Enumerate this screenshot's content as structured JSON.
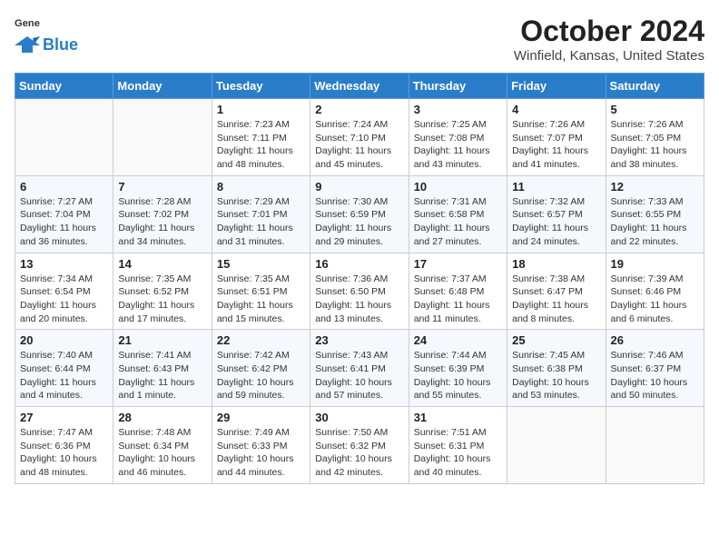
{
  "header": {
    "logo_general": "General",
    "logo_blue": "Blue",
    "month_title": "October 2024",
    "location": "Winfield, Kansas, United States"
  },
  "weekdays": [
    "Sunday",
    "Monday",
    "Tuesday",
    "Wednesday",
    "Thursday",
    "Friday",
    "Saturday"
  ],
  "weeks": [
    [
      {
        "day": "",
        "info": ""
      },
      {
        "day": "",
        "info": ""
      },
      {
        "day": "1",
        "info": "Sunrise: 7:23 AM\nSunset: 7:11 PM\nDaylight: 11 hours and 48 minutes."
      },
      {
        "day": "2",
        "info": "Sunrise: 7:24 AM\nSunset: 7:10 PM\nDaylight: 11 hours and 45 minutes."
      },
      {
        "day": "3",
        "info": "Sunrise: 7:25 AM\nSunset: 7:08 PM\nDaylight: 11 hours and 43 minutes."
      },
      {
        "day": "4",
        "info": "Sunrise: 7:26 AM\nSunset: 7:07 PM\nDaylight: 11 hours and 41 minutes."
      },
      {
        "day": "5",
        "info": "Sunrise: 7:26 AM\nSunset: 7:05 PM\nDaylight: 11 hours and 38 minutes."
      }
    ],
    [
      {
        "day": "6",
        "info": "Sunrise: 7:27 AM\nSunset: 7:04 PM\nDaylight: 11 hours and 36 minutes."
      },
      {
        "day": "7",
        "info": "Sunrise: 7:28 AM\nSunset: 7:02 PM\nDaylight: 11 hours and 34 minutes."
      },
      {
        "day": "8",
        "info": "Sunrise: 7:29 AM\nSunset: 7:01 PM\nDaylight: 11 hours and 31 minutes."
      },
      {
        "day": "9",
        "info": "Sunrise: 7:30 AM\nSunset: 6:59 PM\nDaylight: 11 hours and 29 minutes."
      },
      {
        "day": "10",
        "info": "Sunrise: 7:31 AM\nSunset: 6:58 PM\nDaylight: 11 hours and 27 minutes."
      },
      {
        "day": "11",
        "info": "Sunrise: 7:32 AM\nSunset: 6:57 PM\nDaylight: 11 hours and 24 minutes."
      },
      {
        "day": "12",
        "info": "Sunrise: 7:33 AM\nSunset: 6:55 PM\nDaylight: 11 hours and 22 minutes."
      }
    ],
    [
      {
        "day": "13",
        "info": "Sunrise: 7:34 AM\nSunset: 6:54 PM\nDaylight: 11 hours and 20 minutes."
      },
      {
        "day": "14",
        "info": "Sunrise: 7:35 AM\nSunset: 6:52 PM\nDaylight: 11 hours and 17 minutes."
      },
      {
        "day": "15",
        "info": "Sunrise: 7:35 AM\nSunset: 6:51 PM\nDaylight: 11 hours and 15 minutes."
      },
      {
        "day": "16",
        "info": "Sunrise: 7:36 AM\nSunset: 6:50 PM\nDaylight: 11 hours and 13 minutes."
      },
      {
        "day": "17",
        "info": "Sunrise: 7:37 AM\nSunset: 6:48 PM\nDaylight: 11 hours and 11 minutes."
      },
      {
        "day": "18",
        "info": "Sunrise: 7:38 AM\nSunset: 6:47 PM\nDaylight: 11 hours and 8 minutes."
      },
      {
        "day": "19",
        "info": "Sunrise: 7:39 AM\nSunset: 6:46 PM\nDaylight: 11 hours and 6 minutes."
      }
    ],
    [
      {
        "day": "20",
        "info": "Sunrise: 7:40 AM\nSunset: 6:44 PM\nDaylight: 11 hours and 4 minutes."
      },
      {
        "day": "21",
        "info": "Sunrise: 7:41 AM\nSunset: 6:43 PM\nDaylight: 11 hours and 1 minute."
      },
      {
        "day": "22",
        "info": "Sunrise: 7:42 AM\nSunset: 6:42 PM\nDaylight: 10 hours and 59 minutes."
      },
      {
        "day": "23",
        "info": "Sunrise: 7:43 AM\nSunset: 6:41 PM\nDaylight: 10 hours and 57 minutes."
      },
      {
        "day": "24",
        "info": "Sunrise: 7:44 AM\nSunset: 6:39 PM\nDaylight: 10 hours and 55 minutes."
      },
      {
        "day": "25",
        "info": "Sunrise: 7:45 AM\nSunset: 6:38 PM\nDaylight: 10 hours and 53 minutes."
      },
      {
        "day": "26",
        "info": "Sunrise: 7:46 AM\nSunset: 6:37 PM\nDaylight: 10 hours and 50 minutes."
      }
    ],
    [
      {
        "day": "27",
        "info": "Sunrise: 7:47 AM\nSunset: 6:36 PM\nDaylight: 10 hours and 48 minutes."
      },
      {
        "day": "28",
        "info": "Sunrise: 7:48 AM\nSunset: 6:34 PM\nDaylight: 10 hours and 46 minutes."
      },
      {
        "day": "29",
        "info": "Sunrise: 7:49 AM\nSunset: 6:33 PM\nDaylight: 10 hours and 44 minutes."
      },
      {
        "day": "30",
        "info": "Sunrise: 7:50 AM\nSunset: 6:32 PM\nDaylight: 10 hours and 42 minutes."
      },
      {
        "day": "31",
        "info": "Sunrise: 7:51 AM\nSunset: 6:31 PM\nDaylight: 10 hours and 40 minutes."
      },
      {
        "day": "",
        "info": ""
      },
      {
        "day": "",
        "info": ""
      }
    ]
  ]
}
